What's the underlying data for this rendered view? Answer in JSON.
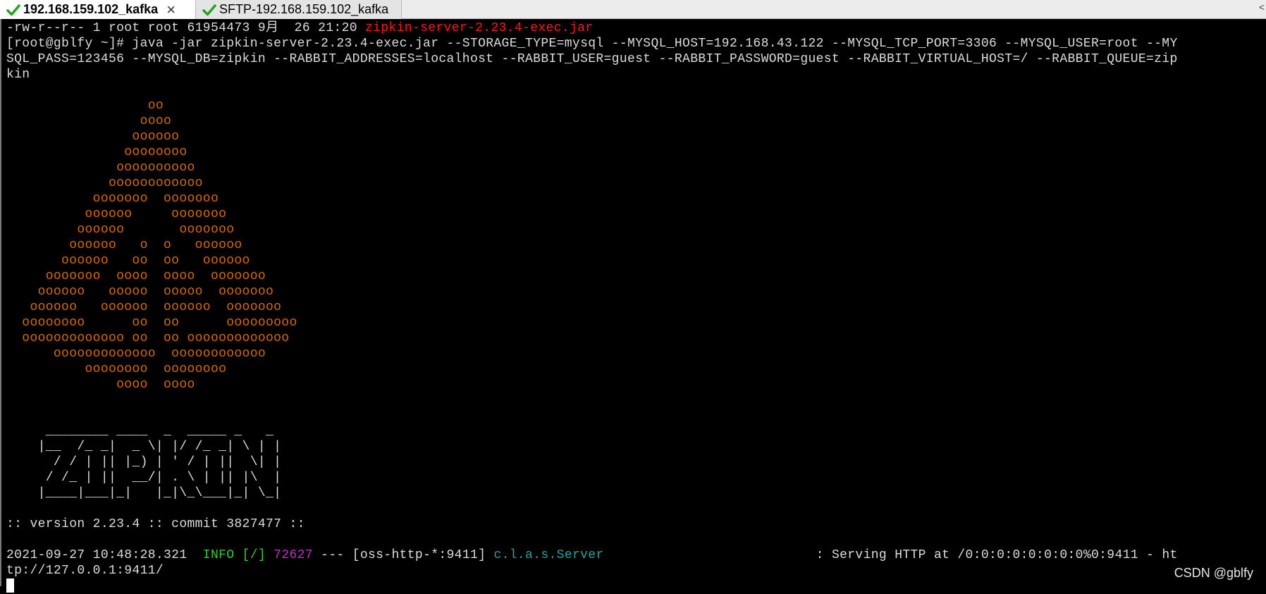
{
  "tabs": [
    {
      "label": "192.168.159.102_kafka",
      "close": "×",
      "icon": "check-icon"
    },
    {
      "label": "SFTP-192.168.159.102_kafka",
      "icon": "check-icon"
    }
  ],
  "scroll_arrow": "<",
  "colors": {
    "check": "#1fa81f",
    "filename": "#ff1a1a",
    "ascii_art": "#d46a0c",
    "log_level": "#3ac63a",
    "pid": "#c030c0",
    "logger": "#2aa0a0"
  },
  "terminal": {
    "ls_line": {
      "prefix": "-rw-r--r-- 1 root root 61954473 9月  26 21:20 ",
      "filename": "zipkin-server-2.23.4-exec.jar"
    },
    "command_lines": [
      "[root@gblfy ~]# java -jar zipkin-server-2.23.4-exec.jar --STORAGE_TYPE=mysql --MYSQL_HOST=192.168.43.122 --MYSQL_TCP_PORT=3306 --MYSQL_USER=root --MY",
      "SQL_PASS=123456 --MYSQL_DB=zipkin --RABBIT_ADDRESSES=localhost --RABBIT_USER=guest --RABBIT_PASSWORD=guest --RABBIT_VIRTUAL_HOST=/ --RABBIT_QUEUE=zip",
      "kin"
    ],
    "ascii_art": [
      "",
      "                  oo",
      "                 oooo",
      "                oooooo",
      "               oooooooo",
      "              oooooooooo",
      "             oooooooooooo",
      "           ooooooo  ooooooo",
      "          oooooo     ooooooo",
      "         oooooo       ooooooo",
      "        oooooo   o  o   oooooo",
      "       oooooo   oo  oo   oooooo",
      "     ooooooo  oooo  oooo  ooooooo",
      "    oooooo   ooooo  ooooo  ooooooo",
      "   oooooo   oooooo  oooooo  ooooooo",
      "  oooooooo      oo  oo      ooooooooo",
      "  ooooooooooooo oo  oo ooooooooooooo",
      "      ooooooooooooo  oooooooooooo",
      "          oooooooo  oooooooo",
      "              oooo  oooo"
    ],
    "zipkin_logo": [
      "",
      "",
      "     ________ ____  _  _____ _   _",
      "    |__  /_ _|  _ \\| |/ /_ _| \\ | |",
      "      / / | || |_) | ' / | ||  \\| |",
      "     / /_ | ||  __/| . \\ | || |\\  |",
      "    |____|___|_|   |_|\\_\\___|_| \\_|"
    ],
    "version_line": ":: version 2.23.4 :: commit 3827477 ::",
    "log": {
      "timestamp": "2021-09-27 10:48:28.321  ",
      "level": "INFO [/]",
      "pid": "72627",
      "separator": " --- ",
      "thread": "[oss-http-*:9411] ",
      "logger": "c.l.a.s.Server",
      "padding": "                           ",
      "message": ": Serving HTTP at /0:0:0:0:0:0:0:0%0:9411 - ht",
      "message_cont": "tp://127.0.0.1:9411/"
    }
  },
  "watermark": "CSDN @gblfy"
}
